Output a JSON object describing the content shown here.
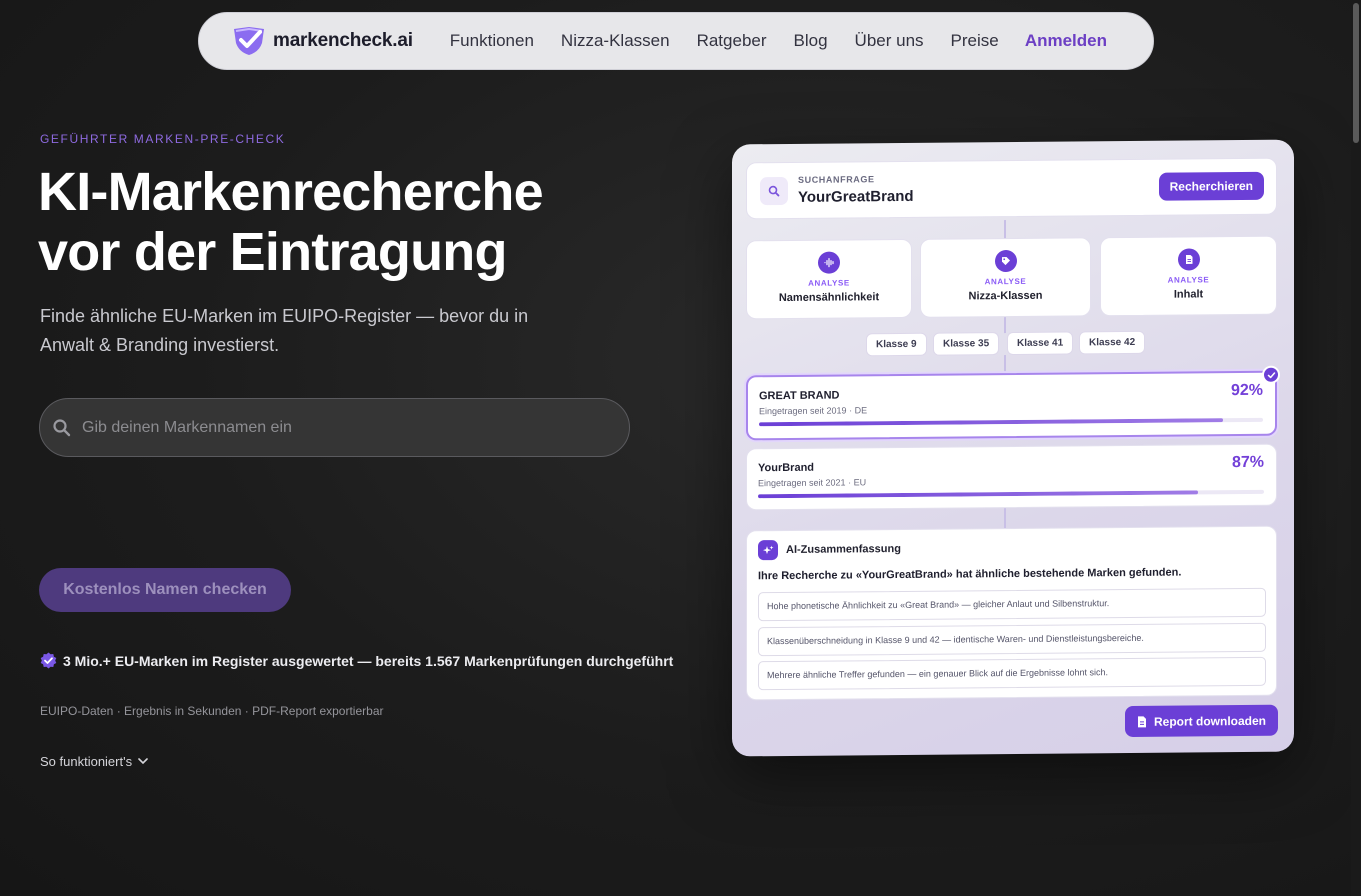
{
  "nav": {
    "logo_text": "markencheck.ai",
    "links": [
      "Funktionen",
      "Nizza-Klassen",
      "Ratgeber",
      "Blog",
      "Über uns",
      "Preise"
    ],
    "login": "Anmelden"
  },
  "hero": {
    "eyebrow": "GEFÜHRTER MARKEN-PRE-CHECK",
    "headline_line1": "KI-Markenrecherche",
    "headline_line2": "vor der Eintragung",
    "subline": "Finde ähnliche EU-Marken im EUIPO-Register — bevor du in Anwalt & Branding investierst.",
    "search_placeholder": "Gib deinen Markennamen ein",
    "cta": "Kostenlos Namen checken",
    "trust": "3 Mio.+ EU-Marken im Register ausgewertet — bereits 1.567 Markenprüfungen durchgeführt",
    "meta": "EUIPO-Daten · Ergebnis in Sekunden · PDF-Report exportierbar",
    "how": "So funktioniert's"
  },
  "card": {
    "query_label": "SUCHANFRAGE",
    "query_value": "YourGreatBrand",
    "query_button": "Recherchieren",
    "analyses": [
      {
        "label": "ANALYSE",
        "name": "Namensähnlichkeit",
        "icon": "waveform-icon"
      },
      {
        "label": "ANALYSE",
        "name": "Nizza-Klassen",
        "icon": "tag-icon"
      },
      {
        "label": "ANALYSE",
        "name": "Inhalt",
        "icon": "document-icon"
      }
    ],
    "classes": [
      "Klasse 9",
      "Klasse 35",
      "Klasse 41",
      "Klasse 42"
    ],
    "matches": [
      {
        "title": "GREAT BRAND",
        "sub": "Eingetragen seit 2019 · DE",
        "pct": "92%",
        "fill": 92
      },
      {
        "title": "YourBrand",
        "sub": "Eingetragen seit 2021 · EU",
        "pct": "87%",
        "fill": 87
      }
    ],
    "summary_title": "AI-Zusammenfassung",
    "summary_headline": "Ihre Recherche zu «YourGreatBrand» hat ähnliche bestehende Marken gefunden.",
    "summary_items": [
      "Hohe phonetische Ähnlichkeit zu «Great Brand» — gleicher Anlaut und Silbenstruktur.",
      "Klassenüberschneidung in Klasse 9 und 42 — identische Waren- und Dienstleistungsbereiche.",
      "Mehrere ähnliche Treffer gefunden — ein genauer Blick auf die Ergebnisse lohnt sich."
    ],
    "report_button": "Report downloaden"
  },
  "colors": {
    "accent": "#6b3fd6",
    "accent_light": "#8b5cf6",
    "cta_bg": "#4e3a7e"
  }
}
